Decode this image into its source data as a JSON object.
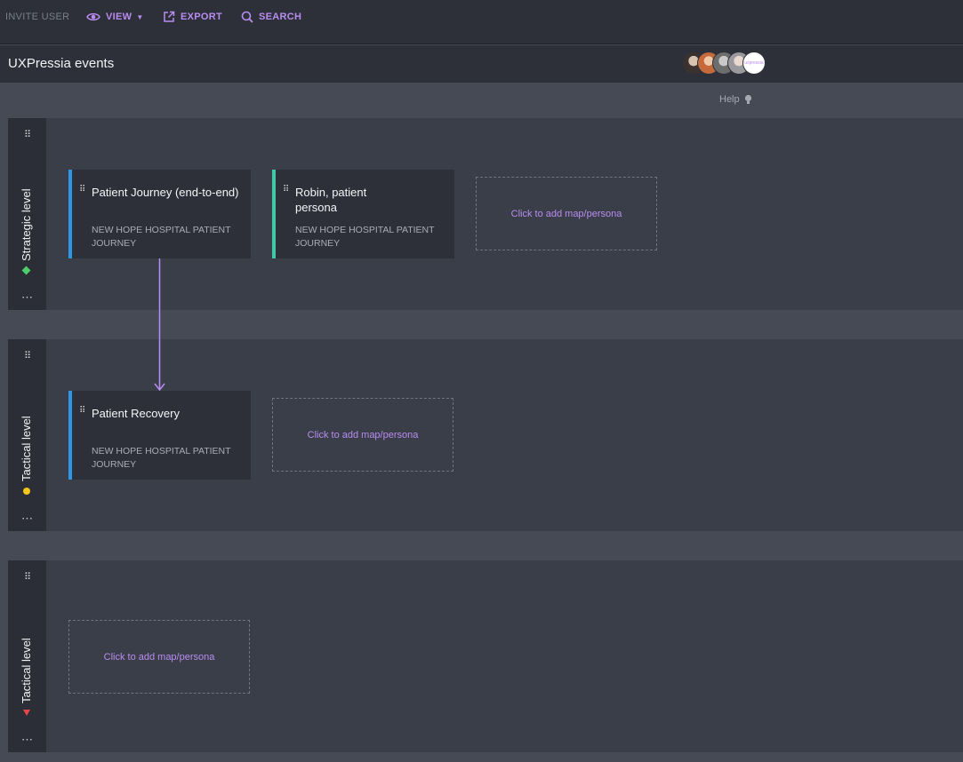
{
  "toolbar": {
    "invite_label": "INVITE USER",
    "view_label": "VIEW",
    "export_label": "EXPORT",
    "search_label": "SEARCH"
  },
  "page": {
    "title": "UXPressia events",
    "avatar_last_text": "uxpressia"
  },
  "help": {
    "label": "Help"
  },
  "lanes": [
    {
      "label": "Strategic level",
      "marker": "diamond",
      "marker_color": "#4ccf6a"
    },
    {
      "label": "Tactical level",
      "marker": "dot",
      "marker_color": "#f5c518"
    },
    {
      "label": "Tactical level",
      "marker": "triangle",
      "marker_color": "#e8474a"
    }
  ],
  "cards": [
    {
      "title": "Patient Journey (end-to-end)",
      "subtitle": "NEW HOPE HOSPITAL PATIENT JOURNEY",
      "accent": "#2d96e6"
    },
    {
      "title": "Robin, patient persona",
      "subtitle": "NEW HOPE HOSPITAL PATIENT JOURNEY",
      "accent": "#3fc9a6"
    },
    {
      "title": "Patient Recovery",
      "subtitle": "NEW HOPE HOSPITAL PATIENT JOURNEY",
      "accent": "#2d96e6"
    }
  ],
  "add_placeholder": "Click to add map/persona",
  "colors": {
    "accent": "#b98cf0",
    "topbar": "#2d3039",
    "background": "#454a54",
    "lane": "#3a3e48"
  }
}
